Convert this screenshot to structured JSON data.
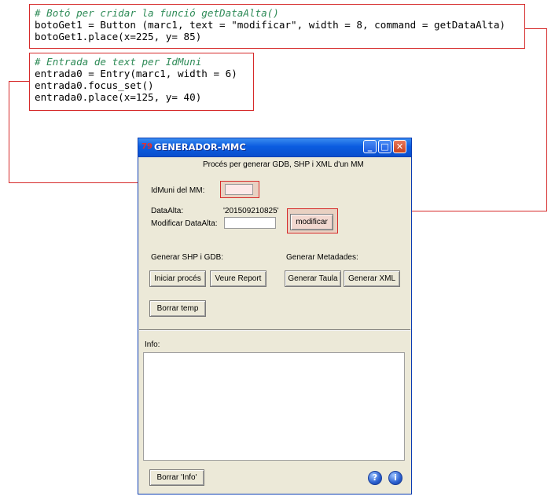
{
  "code1": {
    "comment": "# Botó per cridar la funció getDataAlta()",
    "line1": "botoGet1 = Button (marc1, text = \"modificar\", width = 8, command = getDataAlta)",
    "line2": "botoGet1.place(x=225, y= 85)"
  },
  "code2": {
    "comment": "# Entrada de text per IdMuni",
    "line1": "entrada0 = Entry(marc1, width = 6)",
    "line2": "entrada0.focus_set()",
    "line3": "entrada0.place(x=125, y= 40)"
  },
  "window": {
    "icon": "79",
    "title": "GENERADOR-MMC",
    "min": "_",
    "max": "□",
    "close": "✕"
  },
  "main": {
    "heading": "Procés per generar GDB, SHP i XML d'un MM",
    "idmuni_label": "IdMuni del MM:",
    "dataalta_label": "DataAlta:",
    "dataalta_value": "'201509210825'",
    "modificar_label": "Modificar DataAlta:",
    "modificar_button": "modificar",
    "shp_gdb_label": "Generar SHP i GDB:",
    "metadades_label": "Generar Metadades:",
    "iniciar_button": "Iniciar procés",
    "report_button": "Veure Report",
    "taula_button": "Generar Taula",
    "xml_button": "Generar XML",
    "borrar_temp_button": "Borrar temp",
    "info_label": "Info:",
    "borrar_info_button": "Borrar 'Info'",
    "help_icon": "?",
    "info_icon": "i"
  },
  "colors": {
    "annotation": "#d62a2a",
    "comment": "#2e8b57",
    "titlebar": "#0b5ce0",
    "window_bg": "#ece9d8"
  }
}
